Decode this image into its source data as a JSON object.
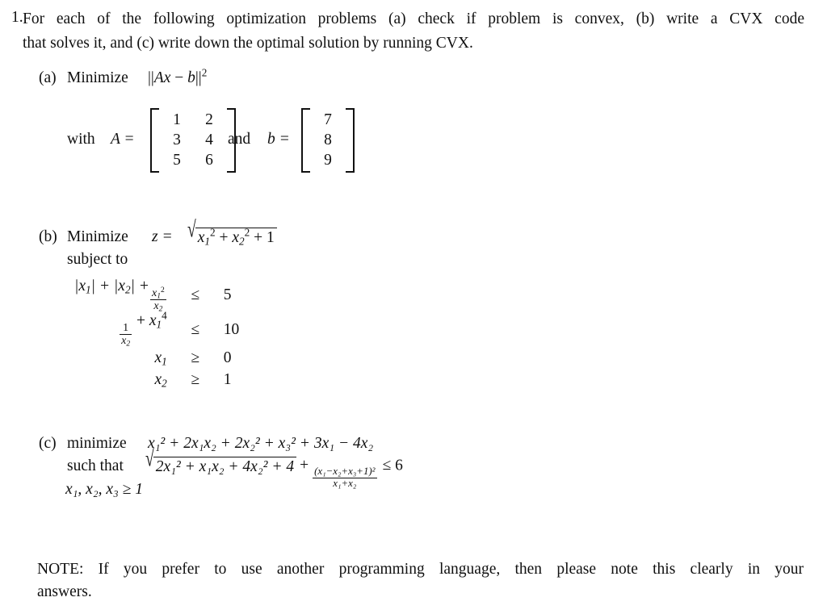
{
  "document": {
    "type": "homework-problem-sheet",
    "background_color": "#ffffff",
    "text_color": "#101010"
  },
  "problem": {
    "number": "1.",
    "statement_line_1": "For each of the following optimization problems (a) check if problem is convex, (b) write a CVX code",
    "statement_line_2": "that solves it, and (c) write down the optimal solution by running CVX."
  },
  "parts": {
    "a": {
      "label": "(a)",
      "objective_word": "Minimize",
      "objective_expr": "||Ax − b||²",
      "norm_open": "||",
      "norm_close": "||",
      "A_symbol": "A",
      "x_symbol": "x",
      "minus": "−",
      "b_symbol": "b",
      "exponent": "2",
      "with_text": "with",
      "A_equals": "A =",
      "and_text": "and",
      "b_equals": "b =",
      "matrix_A": {
        "rows": 3,
        "cols": 2,
        "values": [
          [
            "1",
            "2"
          ],
          [
            "3",
            "4"
          ],
          [
            "5",
            "6"
          ]
        ]
      },
      "vector_b": {
        "rows": 3,
        "cols": 1,
        "values": [
          [
            "7"
          ],
          [
            "8"
          ],
          [
            "9"
          ]
        ]
      }
    },
    "b": {
      "label": "(b)",
      "objective_word": "Minimize",
      "objective_lhs": "z =",
      "sqrt_sign": "√",
      "radicand_parts": [
        "x",
        "1",
        "2",
        "+",
        "x",
        "2",
        "2",
        "+",
        "1"
      ],
      "subject_to": "subject to",
      "constraints": [
        {
          "lhs_tokens": [
            "|x",
            "1",
            "| + |x",
            "2",
            "| +"
          ],
          "has_fraction": true,
          "fraction_num_base": "x",
          "fraction_num_sub": "1",
          "fraction_num_sup": "2",
          "fraction_den_base": "x",
          "fraction_den_sub": "2",
          "relation": "≤",
          "rhs": "5"
        },
        {
          "has_fraction": true,
          "fraction_num_base": "1",
          "fraction_den_base": "x",
          "fraction_den_sub": "2",
          "tail_plus": "+",
          "tail_base": "x",
          "tail_sub": "1",
          "tail_sup": "4",
          "relation": "≤",
          "rhs": "10"
        },
        {
          "lhs_base": "x",
          "lhs_sub": "1",
          "relation": "≥",
          "rhs": "0"
        },
        {
          "lhs_base": "x",
          "lhs_sub": "2",
          "relation": "≥",
          "rhs": "1"
        }
      ]
    },
    "c": {
      "label": "(c)",
      "objective_word": "minimize",
      "objective_expr": "x₁² + 2x₁x₂ + 2x₂² + x₃² + 3x₁ − 4x₂",
      "such_that": "such that",
      "sqrt_sign": "√",
      "sqrt_radicand": "2x₁² + x₁x₂ + 4x₂² + 4",
      "plus": "+",
      "fraction_numerator": "(x₁−x₂+x₃+1)²",
      "fraction_denominator": "x₁+x₂",
      "relation": "≤",
      "rhs": "6",
      "bound_line": "x₁, x₂, x₃ ≥ 1"
    }
  },
  "note": {
    "line_1": "NOTE: If you prefer to use another programming language, then please note this clearly in your",
    "line_2": "answers."
  },
  "symbols": {
    "leq": "≤",
    "geq": "≥",
    "minus": "−",
    "plus": "+",
    "sqrt": "√",
    "equals": "="
  }
}
